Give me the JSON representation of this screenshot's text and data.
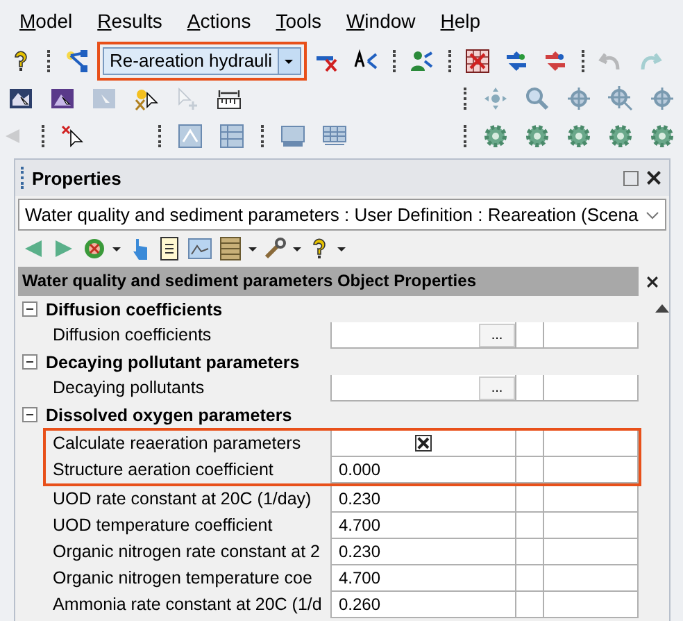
{
  "menu": [
    {
      "label": "Model"
    },
    {
      "label": "Results"
    },
    {
      "label": "Actions"
    },
    {
      "label": "Tools"
    },
    {
      "label": "Window"
    },
    {
      "label": "Help"
    }
  ],
  "toolbar": {
    "scenario_combo": {
      "value": "Re-areation hydrauli",
      "highlighted": true
    }
  },
  "properties_panel": {
    "title": "Properties",
    "object_selector": {
      "value": "Water quality and sediment parameters : User Definition : Reareation (Scena"
    },
    "grid_title": "Water quality and sediment parameters Object Properties",
    "categories": [
      {
        "label": "Diffusion coefficients",
        "expanded": true,
        "rows": [
          {
            "label": "Diffusion coefficients",
            "kind": "ellipsis",
            "button": "...",
            "highlighted": false
          }
        ]
      },
      {
        "label": "Decaying pollutant parameters",
        "expanded": true,
        "rows": [
          {
            "label": "Decaying pollutants",
            "kind": "ellipsis",
            "button": "...",
            "highlighted": false
          }
        ]
      },
      {
        "label": "Dissolved oxygen parameters",
        "expanded": true,
        "rows": [
          {
            "label": "Calculate reaeration parameters",
            "kind": "checkbox",
            "checked": true,
            "highlighted": true
          },
          {
            "label": "Structure aeration coefficient",
            "kind": "number",
            "value": "0.000",
            "highlighted": true
          },
          {
            "label": "UOD rate constant at 20C (1/day)",
            "kind": "number",
            "value": "0.230",
            "highlighted": false
          },
          {
            "label": "UOD temperature coefficient",
            "kind": "number",
            "value": "4.700",
            "highlighted": false
          },
          {
            "label": "Organic nitrogen rate constant at 2",
            "kind": "number",
            "value": "0.230",
            "highlighted": false
          },
          {
            "label": "Organic nitrogen temperature coe",
            "kind": "number",
            "value": "4.700",
            "highlighted": false
          },
          {
            "label": "Ammonia rate constant at 20C (1/d",
            "kind": "number",
            "value": "0.260",
            "highlighted": false
          }
        ]
      }
    ]
  }
}
